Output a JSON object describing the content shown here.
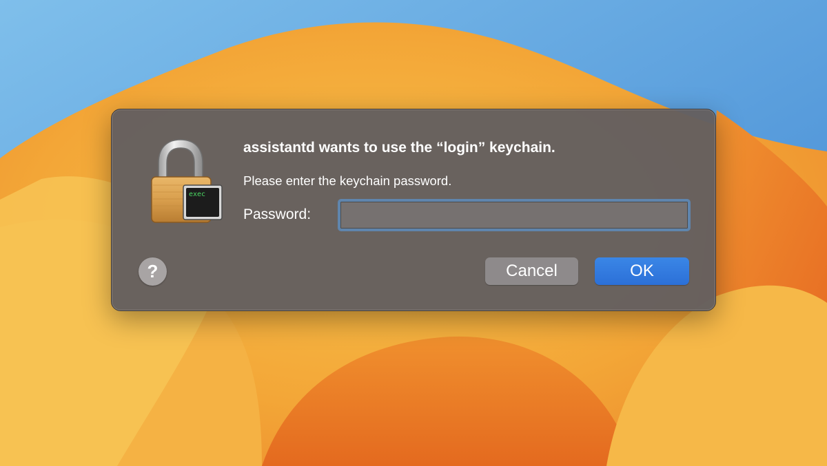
{
  "dialog": {
    "title": "assistantd wants to use the “login” keychain.",
    "message": "Please enter the keychain password.",
    "password_label": "Password:",
    "password_value": "",
    "help_label": "?",
    "cancel_label": "Cancel",
    "ok_label": "OK",
    "icon": "keychain-lock-icon",
    "icon_badge_text": "exec"
  },
  "colors": {
    "dialog_bg": "#645f5f",
    "ok_button": "#2f76dd",
    "cancel_button": "#8e8a8b",
    "focus_ring": "#5f85ad",
    "badge_text": "#4cd964"
  }
}
